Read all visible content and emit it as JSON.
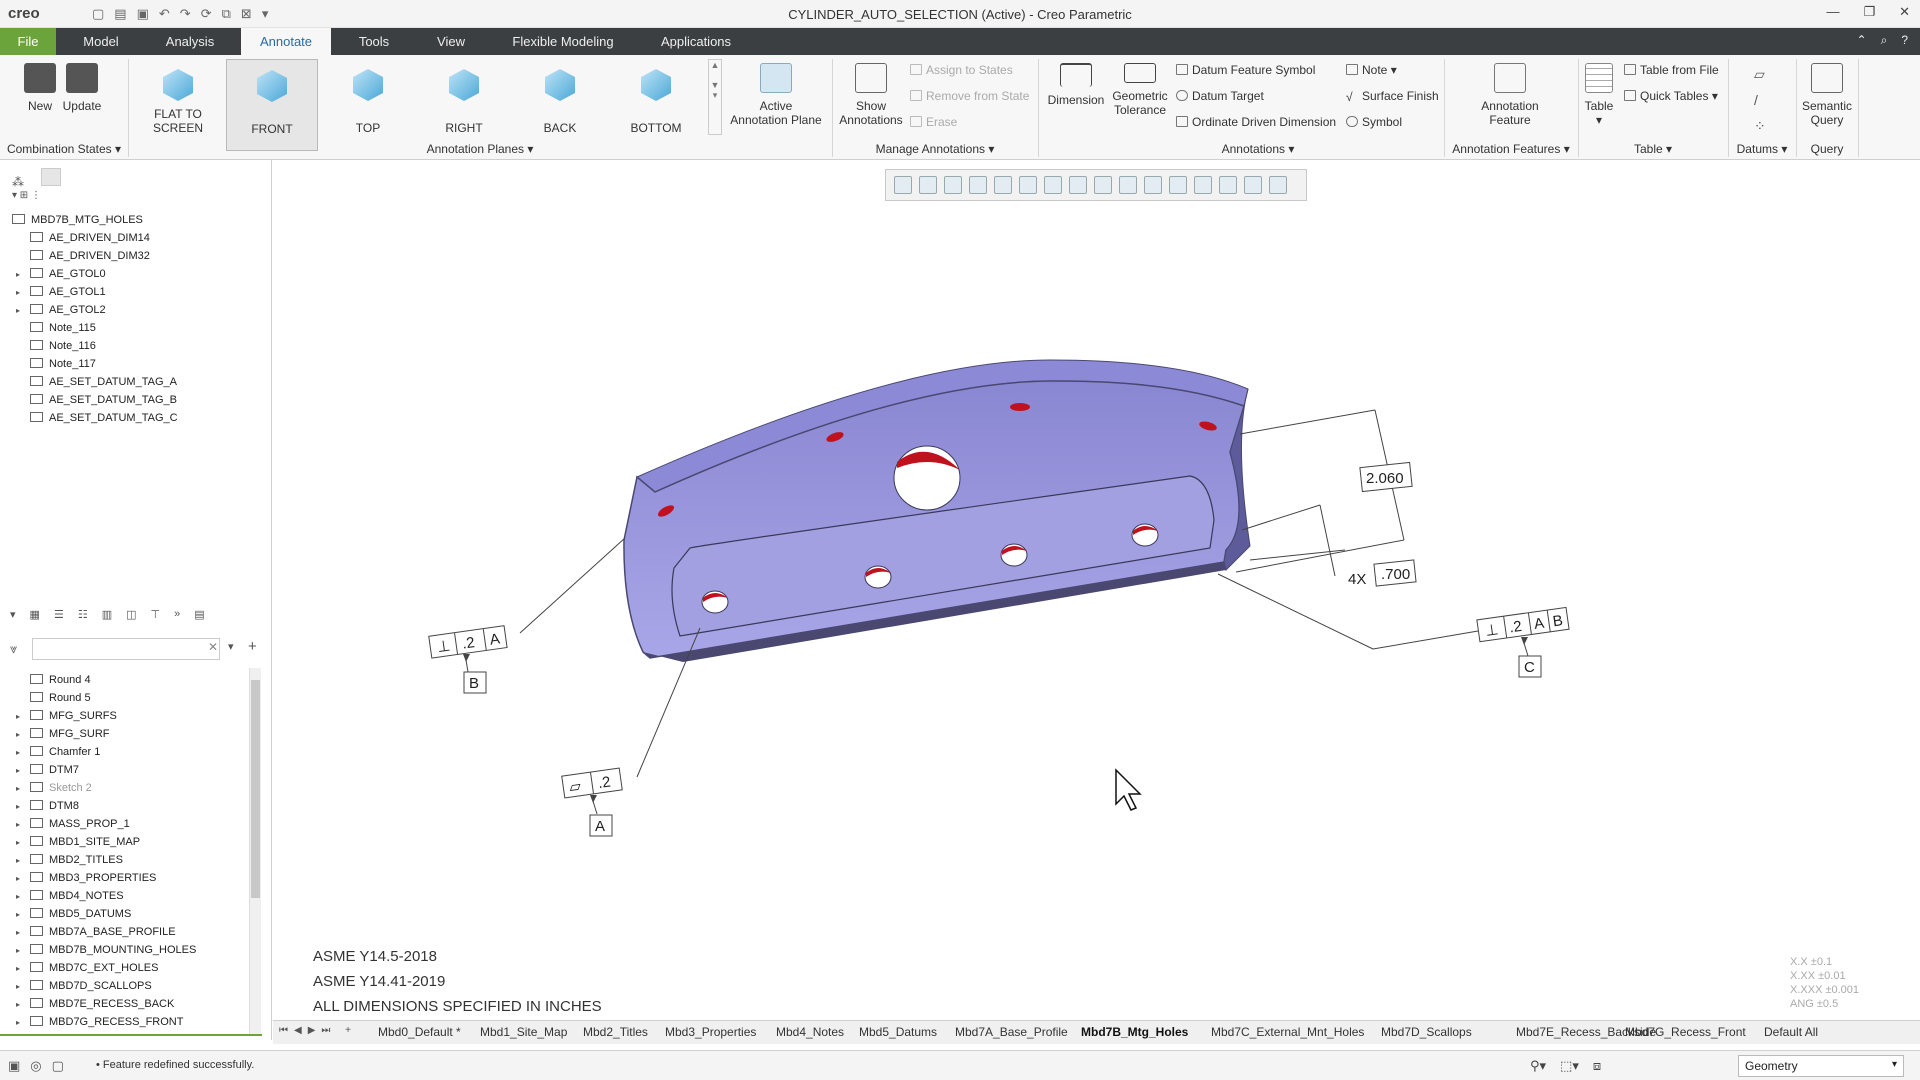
{
  "app": {
    "logo": "creo",
    "window_title": "CYLINDER_AUTO_SELECTION (Active) - Creo Parametric"
  },
  "menu": {
    "file": "File",
    "tabs": [
      "Model",
      "Analysis",
      "Annotate",
      "Tools",
      "View",
      "Flexible Modeling",
      "Applications"
    ],
    "active": "Annotate"
  },
  "ribbon": {
    "new": "New",
    "update": "Update",
    "combination_states": "Combination States",
    "planes": [
      "FLAT TO SCREEN",
      "FRONT",
      "TOP",
      "RIGHT",
      "BACK",
      "BOTTOM"
    ],
    "active_plane_l1": "Active",
    "active_plane_l2": "Annotation Plane",
    "annotation_planes": "Annotation Planes",
    "show_l1": "Show",
    "show_l2": "Annotations",
    "assign": "Assign to States",
    "remove": "Remove from State",
    "erase": "Erase",
    "manage": "Manage Annotations",
    "dimension": "Dimension",
    "geo_l1": "Geometric",
    "geo_l2": "Tolerance",
    "datum_feature_symbol": "Datum Feature Symbol",
    "datum_target": "Datum Target",
    "ordinate": "Ordinate Driven Dimension",
    "note": "Note",
    "surface_finish": "Surface Finish",
    "symbol": "Symbol",
    "annotations": "Annotations",
    "af_l1": "Annotation",
    "af_l2": "Feature",
    "annotation_features": "Annotation Features",
    "table": "Table",
    "table_from_file": "Table from File",
    "quick_tables": "Quick Tables",
    "table_group": "Table",
    "datums": "Datums",
    "sq_l1": "Semantic",
    "sq_l2": "Query",
    "query": "Query"
  },
  "model_tree": {
    "root": "MBD7B_MTG_HOLES",
    "items": [
      "AE_DRIVEN_DIM14",
      "AE_DRIVEN_DIM32",
      "AE_GTOL0",
      "AE_GTOL1",
      "AE_GTOL2",
      "Note_115",
      "Note_116",
      "Note_117",
      "AE_SET_DATUM_TAG_A",
      "AE_SET_DATUM_TAG_B",
      "AE_SET_DATUM_TAG_C"
    ]
  },
  "feature_tree": [
    "Round 4",
    "Round 5",
    "MFG_SURFS",
    "MFG_SURF",
    "Chamfer 1",
    "DTM7",
    "Sketch 2",
    "DTM8",
    "MASS_PROP_1",
    "MBD1_SITE_MAP",
    "MBD2_TITLES",
    "MBD3_PROPERTIES",
    "MBD4_NOTES",
    "MBD5_DATUMS",
    "MBD7A_BASE_PROFILE",
    "MBD7B_MOUNTING_HOLES",
    "MBD7C_EXT_HOLES",
    "MBD7D_SCALLOPS",
    "MBD7E_RECESS_BACK",
    "MBD7G_RECESS_FRONT"
  ],
  "annotations": {
    "dim1": "2.060",
    "dim2_prefix": "4X",
    "dim2": ".700",
    "fcf_b_sym": "⊥",
    "fcf_b_tol": ".2",
    "fcf_b_datum": "A",
    "datum_b": "B",
    "fcf_c_sym": "⊥",
    "fcf_c_tol": ".2",
    "fcf_c_d1": "A",
    "fcf_c_d2": "B",
    "datum_c": "C",
    "fcf_a_sym": "▱",
    "fcf_a_tol": ".2",
    "datum_a": "A"
  },
  "notes": [
    "ASME Y14.5-2018",
    "ASME Y14.41-2019",
    "ALL DIMENSIONS SPECIFIED IN INCHES"
  ],
  "tolerances": [
    "X.X ±0.1",
    "X.XX ±0.01",
    "X.XXX ±0.001",
    "ANG ±0.5"
  ],
  "sheets": [
    "Mbd0_Default *",
    "Mbd1_Site_Map",
    "Mbd2_Titles",
    "Mbd3_Properties",
    "Mbd4_Notes",
    "Mbd5_Datums",
    "Mbd7A_Base_Profile",
    "Mbd7B_Mtg_Holes",
    "Mbd7C_External_Mnt_Holes",
    "Mbd7D_Scallops",
    "Mbd7E_Recess_Backside",
    "Mbd7G_Recess_Front",
    "Default All"
  ],
  "status": {
    "message": "Feature redefined successfully.",
    "filter": "Geometry"
  },
  "colors": {
    "model_face": "#9b98de",
    "model_edge": "#4a4870",
    "hole": "#c0121e",
    "file_tab": "#6aa43a",
    "menubar": "#3b3f42"
  }
}
